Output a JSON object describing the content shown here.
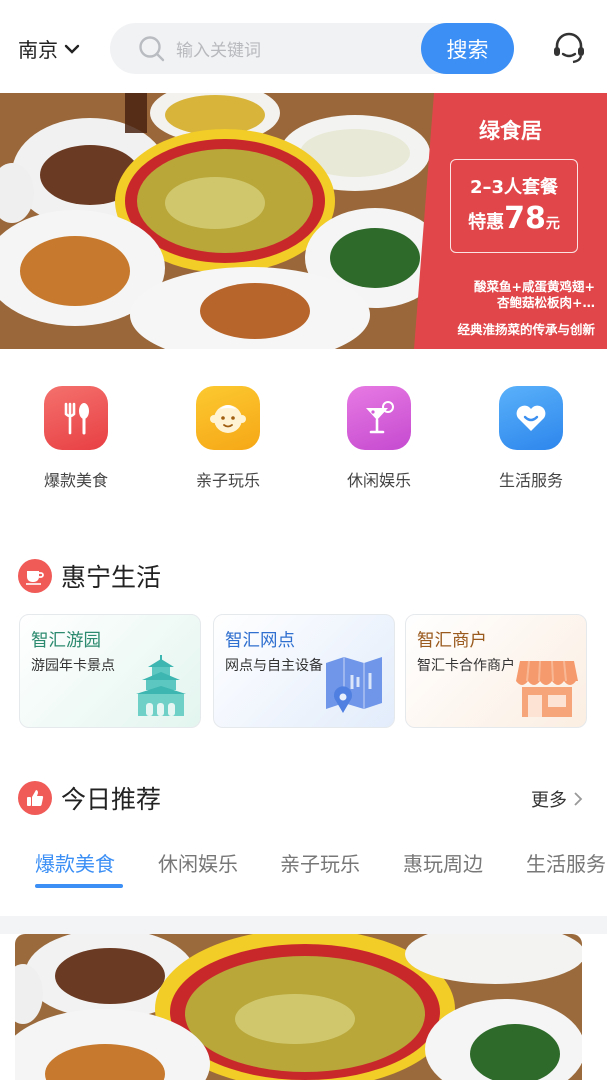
{
  "header": {
    "city": "南京",
    "search_placeholder": "输入关键词",
    "search_button": "搜索"
  },
  "banner": {
    "brand": "绿食居",
    "set_name": "2–3人套餐",
    "price_prefix": "特惠",
    "price": "78",
    "price_unit": "元",
    "dishes_line1": "酸菜鱼+咸蛋黄鸡翅+",
    "dishes_line2": "杏鲍菇松板肉+…",
    "slogan": "经典淮扬菜的传承与创新"
  },
  "categories": [
    {
      "label": "爆款美食",
      "icon": "fork-spoon-icon",
      "color": "#ef4f50"
    },
    {
      "label": "亲子玩乐",
      "icon": "baby-face-icon",
      "color": "#f8b520"
    },
    {
      "label": "休闲娱乐",
      "icon": "cocktail-icon",
      "color": "#d95ad4"
    },
    {
      "label": "生活服务",
      "icon": "heart-icon",
      "color": "#3f9af2"
    }
  ],
  "huining": {
    "title": "惠宁生活",
    "cards": [
      {
        "title": "智汇游园",
        "subtitle": "游园年卡景点",
        "title_color": "#2c8a6e",
        "icon": "pagoda-icon"
      },
      {
        "title": "智汇网点",
        "subtitle": "网点与自主设备",
        "title_color": "#2f6fcf",
        "icon": "map-pin-icon"
      },
      {
        "title": "智汇商户",
        "subtitle": "智汇卡合作商户",
        "title_color": "#9a5a1e",
        "icon": "shop-icon"
      }
    ]
  },
  "today": {
    "title": "今日推荐",
    "more": "更多",
    "tabs": [
      "爆款美食",
      "休闲娱乐",
      "亲子玩乐",
      "惠玩周边",
      "生活服务"
    ],
    "active_tab": 0
  }
}
